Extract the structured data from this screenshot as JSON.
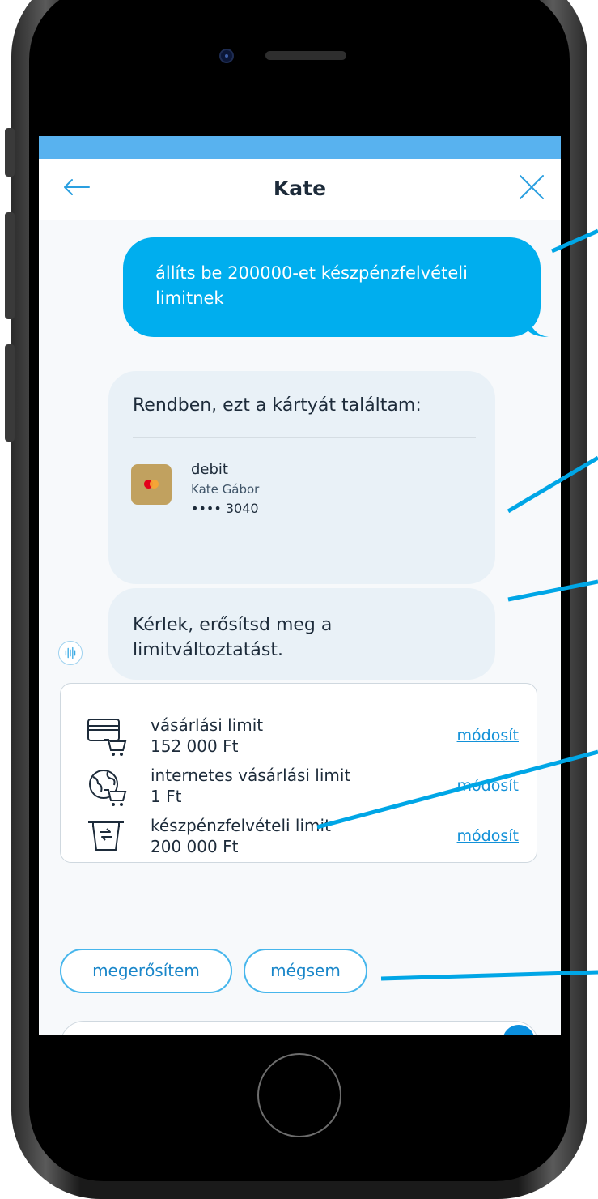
{
  "header": {
    "title": "Kate"
  },
  "chat": {
    "user_message": "állíts be 200000-et készpénzfelvételi limitnek",
    "bot_found_text": "Rendben, ezt a kártyát találtam:",
    "card": {
      "name": "debit",
      "holder": "Kate Gábor",
      "number": "•••• 3040",
      "icon": "mastercard-icon"
    },
    "bot_confirm_text": "Kérlek, erősítsd meg a limitváltoztatást."
  },
  "limits": [
    {
      "label": "vásárlási limit",
      "value": "152 000 Ft",
      "action": "módosít",
      "icon": "card-cart-icon"
    },
    {
      "label": "internetes vásárlási limit",
      "value": "1 Ft",
      "action": "módosít",
      "icon": "globe-cart-icon"
    },
    {
      "label": "készpénzfelvételi limit",
      "value": "200 000 Ft",
      "action": "módosít",
      "icon": "atm-icon"
    }
  ],
  "quick_replies": {
    "confirm": "megerősítem",
    "cancel": "mégsem"
  },
  "colors": {
    "accent": "#00aeee",
    "status_bar": "#58b2ef",
    "link": "#1291d8",
    "bot_bubble": "#e9f1f7",
    "callout": "#00a6e6"
  }
}
